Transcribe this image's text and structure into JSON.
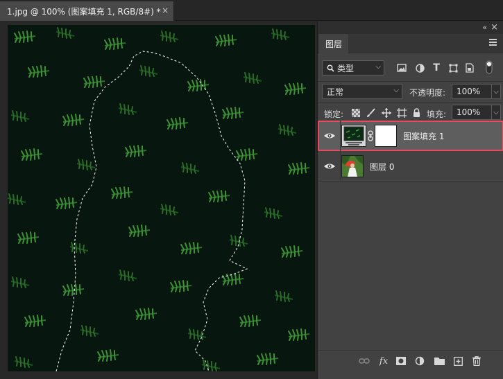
{
  "document": {
    "tab_title": "1.jpg @ 100% (图案填充 1, RGB/8#) *",
    "close_glyph": "×"
  },
  "panel": {
    "collapse_glyph": "«",
    "close_glyph": "×",
    "tab_label": "图层",
    "filter": {
      "label": "类型",
      "icons": [
        "image-filter-icon",
        "adjustment-filter-icon",
        "type-filter-icon",
        "shape-filter-icon",
        "smart-object-filter-icon",
        "filter-toggle"
      ]
    },
    "blend_mode": "正常",
    "opacity_label": "不透明度:",
    "opacity_value": "100%",
    "lock_label": "锁定:",
    "fill_label": "填充:",
    "fill_value": "100%",
    "layers": [
      {
        "name": "图案填充 1",
        "visible": true,
        "selected": true,
        "type": "pattern-fill"
      },
      {
        "name": "图层 0",
        "visible": true,
        "selected": false,
        "type": "pixel"
      }
    ],
    "bottom_actions": [
      "link-layers",
      "add-style",
      "add-mask",
      "new-adjustment",
      "new-group",
      "new-layer",
      "delete-layer"
    ],
    "fx_label": "fx"
  },
  "colors": {
    "selection_highlight": "#e84a5f",
    "panel_bg": "#424242",
    "selected_row": "#5e5e5e"
  }
}
